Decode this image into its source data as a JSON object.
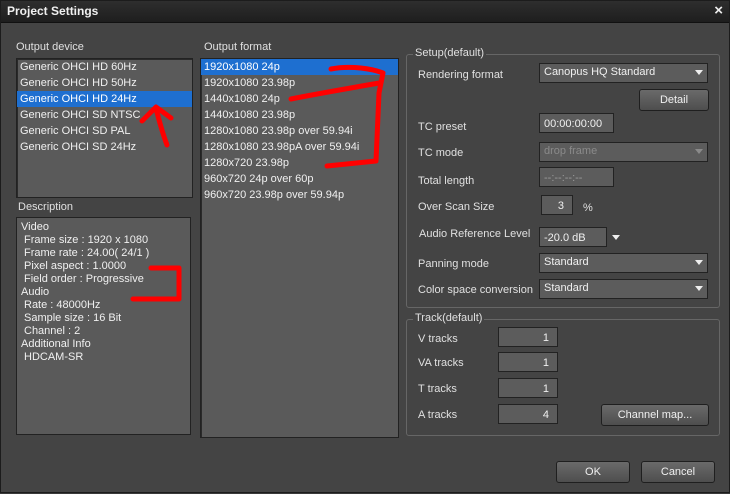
{
  "window": {
    "title": "Project Settings",
    "close": "×"
  },
  "output_device": {
    "label": "Output device",
    "items": [
      "Generic OHCI HD 60Hz",
      "Generic OHCI HD 50Hz",
      "Generic OHCI HD 24Hz",
      "Generic OHCI SD NTSC",
      "Generic OHCI SD PAL",
      "Generic OHCI SD 24Hz"
    ],
    "selected_index": 2
  },
  "output_format": {
    "label": "Output format",
    "items": [
      "1920x1080 24p",
      "1920x1080 23.98p",
      "1440x1080 24p",
      "1440x1080 23.98p",
      "1280x1080 23.98p over 59.94i",
      "1280x1080 23.98pA over 59.94i",
      "1280x720 23.98p",
      "960x720 24p over 60p",
      "960x720 23.98p over 59.94p"
    ],
    "selected_index": 0
  },
  "description": {
    "label": "Description",
    "lines": [
      "Video",
      "Frame size : 1920 x 1080",
      "Frame rate : 24.00( 24/1 )",
      "Pixel aspect : 1.0000",
      "Field order : Progressive",
      "Audio",
      "Rate : 48000Hz",
      "Sample size : 16 Bit",
      "Channel : 2",
      "Additional Info",
      "HDCAM-SR"
    ]
  },
  "setup": {
    "group_title": "Setup(default)",
    "rendering_format": {
      "label": "Rendering format",
      "value": "Canopus HQ Standard"
    },
    "detail_button": "Detail",
    "tc_preset": {
      "label": "TC preset",
      "value": "00:00:00:00"
    },
    "tc_mode": {
      "label": "TC mode",
      "value": "drop frame"
    },
    "total_length": {
      "label": "Total length",
      "value": "--:--:--:--"
    },
    "over_scan": {
      "label": "Over Scan Size",
      "value": "3",
      "unit": "%"
    },
    "audio_ref": {
      "label": "Audio Reference Level",
      "value": "-20.0 dB"
    },
    "panning": {
      "label": "Panning mode",
      "value": "Standard"
    },
    "color_space": {
      "label": "Color space conversion",
      "value": "Standard"
    }
  },
  "track": {
    "group_title": "Track(default)",
    "v_tracks": {
      "label": "V tracks",
      "value": "1"
    },
    "va_tracks": {
      "label": "VA tracks",
      "value": "1"
    },
    "t_tracks": {
      "label": "T tracks",
      "value": "1"
    },
    "a_tracks": {
      "label": "A tracks",
      "value": "4"
    },
    "channel_map_button": "Channel map..."
  },
  "footer": {
    "ok": "OK",
    "cancel": "Cancel"
  },
  "colors": {
    "selection": "#1e6fd0",
    "annotation": "#ff0000"
  }
}
